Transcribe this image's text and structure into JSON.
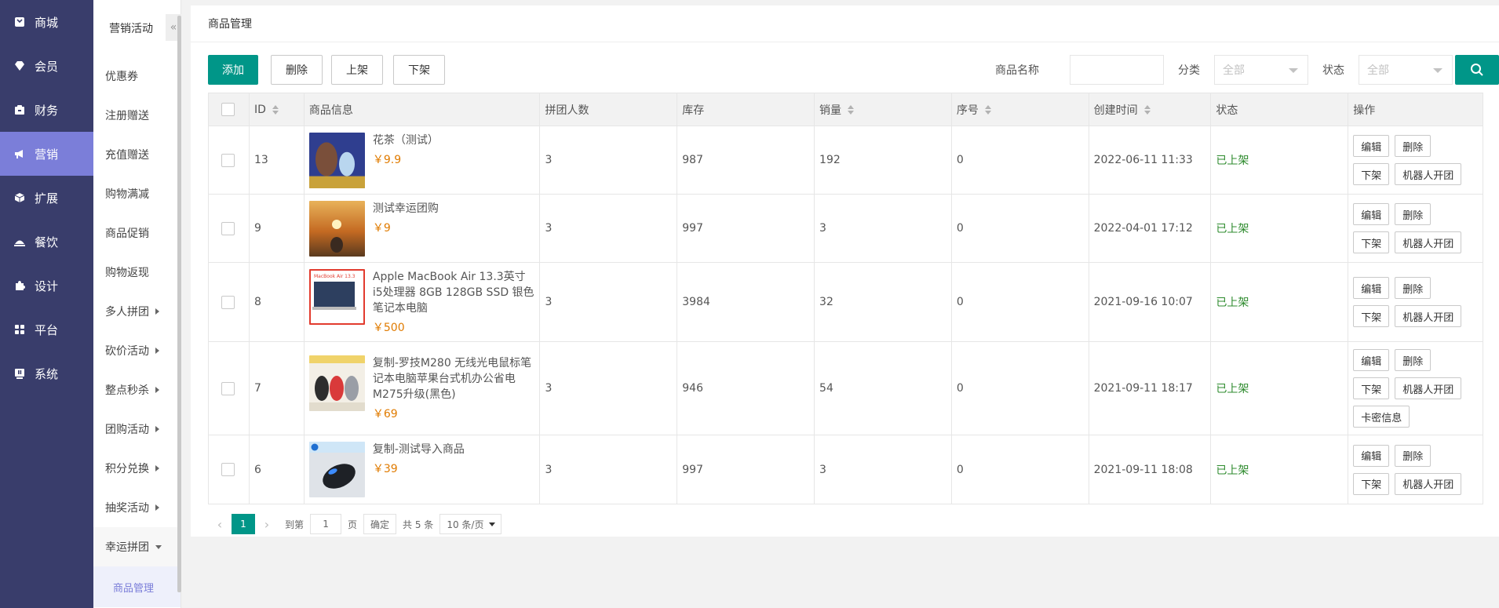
{
  "sidebar": {
    "items": [
      {
        "label": "商城",
        "icon": "store-icon"
      },
      {
        "label": "会员",
        "icon": "member-icon"
      },
      {
        "label": "财务",
        "icon": "finance-icon"
      },
      {
        "label": "营销",
        "icon": "megaphone-icon",
        "active": true
      },
      {
        "label": "扩展",
        "icon": "extension-icon"
      },
      {
        "label": "餐饮",
        "icon": "dining-icon"
      },
      {
        "label": "设计",
        "icon": "puzzle-icon"
      },
      {
        "label": "平台",
        "icon": "grid-icon"
      },
      {
        "label": "系统",
        "icon": "system-icon"
      }
    ]
  },
  "subnav": {
    "title": "营销活动",
    "collapse_glyph": "«",
    "items": [
      {
        "label": "优惠券"
      },
      {
        "label": "注册赠送"
      },
      {
        "label": "充值赠送"
      },
      {
        "label": "购物满减"
      },
      {
        "label": "商品促销"
      },
      {
        "label": "购物返现"
      },
      {
        "label": "多人拼团",
        "arrow": "right"
      },
      {
        "label": "砍价活动",
        "arrow": "right"
      },
      {
        "label": "整点秒杀",
        "arrow": "right"
      },
      {
        "label": "团购活动",
        "arrow": "right"
      },
      {
        "label": "积分兑换",
        "arrow": "right"
      },
      {
        "label": "抽奖活动",
        "arrow": "right"
      },
      {
        "label": "幸运拼团",
        "arrow": "down"
      }
    ],
    "active_sub": "商品管理"
  },
  "page": {
    "title": "商品管理"
  },
  "toolbar": {
    "add": "添加",
    "delete": "删除",
    "on_shelf": "上架",
    "off_shelf": "下架",
    "name_label": "商品名称",
    "name_value": "",
    "category_label": "分类",
    "category_value": "全部",
    "status_label": "状态",
    "status_value": "全部"
  },
  "table": {
    "headers": {
      "id": "ID",
      "info": "商品信息",
      "group_size": "拼团人数",
      "stock": "库存",
      "sales": "销量",
      "order": "序号",
      "created": "创建时间",
      "status": "状态",
      "ops": "操作"
    },
    "rows": [
      {
        "id": "13",
        "name": "花茶（测试）",
        "price": "￥9.9",
        "group_size": "3",
        "stock": "987",
        "sales": "192",
        "order": "0",
        "created": "2022-06-11 11:33",
        "status": "已上架",
        "ops": [
          "编辑",
          "删除",
          "下架",
          "机器人开团"
        ],
        "thumb": "tea"
      },
      {
        "id": "9",
        "name": "测试幸运团购",
        "price": "￥9",
        "group_size": "3",
        "stock": "997",
        "sales": "3",
        "order": "0",
        "created": "2022-04-01 17:12",
        "status": "已上架",
        "ops": [
          "编辑",
          "删除",
          "下架",
          "机器人开团"
        ],
        "thumb": "sunset"
      },
      {
        "id": "8",
        "name": "Apple MacBook Air 13.3英寸 i5处理器 8GB 128GB SSD 银色笔记本电脑",
        "price": "￥500",
        "group_size": "3",
        "stock": "3984",
        "sales": "32",
        "order": "0",
        "created": "2021-09-16 10:07",
        "status": "已上架",
        "ops": [
          "编辑",
          "删除",
          "下架",
          "机器人开团"
        ],
        "thumb": "macbook",
        "thumb_text": "MacBook Air 13.3"
      },
      {
        "id": "7",
        "name": "复制-罗技M280 无线光电鼠标笔记本电脑苹果台式机办公省电M275升级(黑色)",
        "price": "￥69",
        "group_size": "3",
        "stock": "946",
        "sales": "54",
        "order": "0",
        "created": "2021-09-11 18:17",
        "status": "已上架",
        "ops": [
          "编辑",
          "删除",
          "下架",
          "机器人开团",
          "卡密信息"
        ],
        "thumb": "mice"
      },
      {
        "id": "6",
        "name": "复制-测试导入商品",
        "price": "￥39",
        "group_size": "3",
        "stock": "997",
        "sales": "3",
        "order": "0",
        "created": "2021-09-11 18:08",
        "status": "已上架",
        "ops": [
          "编辑",
          "删除",
          "下架",
          "机器人开团"
        ],
        "thumb": "mouse"
      }
    ]
  },
  "pager": {
    "current": "1",
    "goto_label": "到第",
    "page_value": "1",
    "page_unit": "页",
    "confirm": "确定",
    "total": "共 5 条",
    "page_size": "10 条/页"
  },
  "colors": {
    "sidebar_bg": "#393d6b",
    "sidebar_active": "#7b7ed9",
    "primary": "#009688",
    "status_green": "#2e8b2e",
    "price_orange": "#e07b00"
  }
}
